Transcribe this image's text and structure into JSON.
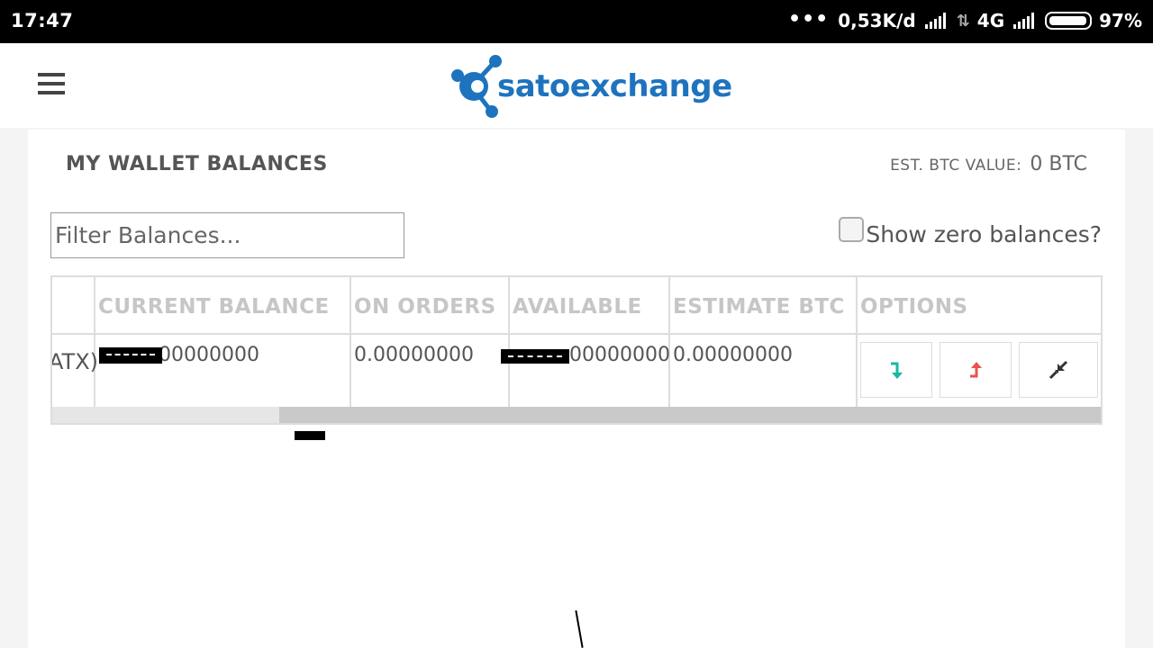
{
  "status_bar": {
    "time": "17:47",
    "dots": "•••",
    "network_speed": "0,53K/d",
    "network_type": "4G",
    "battery": "97%",
    "battery_level": 0.97
  },
  "header": {
    "menu_icon": "hamburger-icon",
    "logo_text": "satoexchange",
    "logo_icon": "molecule-logo-icon",
    "brand_color": "#1e73be"
  },
  "wallet": {
    "title": "MY WALLET BALANCES",
    "est_label": "EST. BTC VALUE:",
    "est_value": "0 BTC",
    "filter_placeholder": "Filter Balances...",
    "zero_label": "Show zero balances?",
    "columns": [
      "CURRENT BALANCE",
      "ON ORDERS",
      "AVAILABLE",
      "ESTIMATE BTC",
      "OPTIONS"
    ],
    "rows": [
      {
        "coin": "ATX)",
        "current_balance": "00000000",
        "on_orders": "0.00000000",
        "available": "00000000",
        "estimate_btc": "0.00000000",
        "options": [
          {
            "icon": "deposit-arrow-down-icon",
            "color": "#1bb7a6"
          },
          {
            "icon": "withdraw-arrow-up-icon",
            "color": "#e8534a"
          },
          {
            "icon": "compress-arrows-icon",
            "color": "#333333"
          }
        ]
      }
    ],
    "scroll_position": 0.22
  }
}
